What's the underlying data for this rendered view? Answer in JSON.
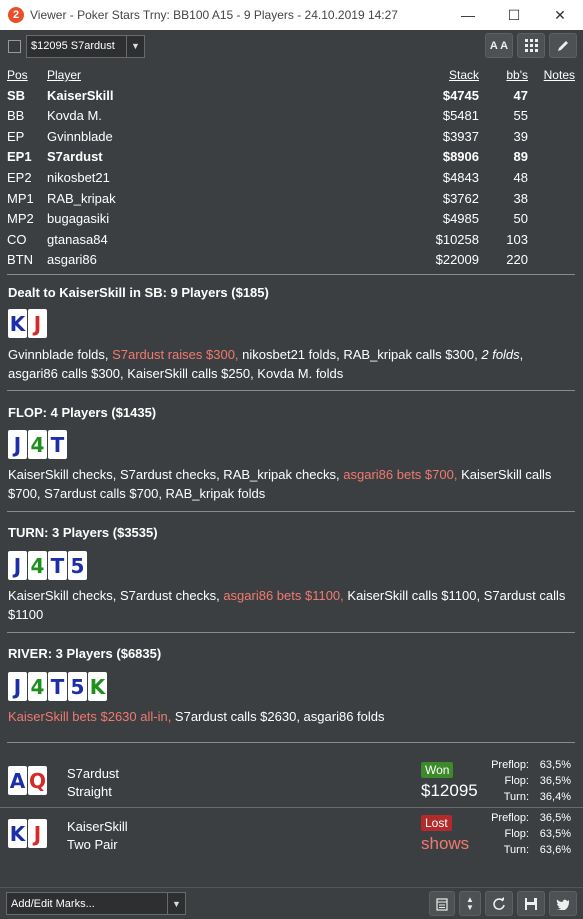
{
  "window": {
    "logo": "2",
    "title": "Viewer - Poker Stars Trny: BB100 A15 - 9 Players - 24.10.2019 14:27",
    "minimize": "—",
    "maximize": "☐",
    "close": "✕"
  },
  "toolbar": {
    "player_select": "$12095 S7ardust",
    "font_btn": "A A",
    "grid_icon": "grid-icon",
    "edit_icon": "pencil-icon"
  },
  "table": {
    "headers": {
      "pos": "Pos",
      "player": "Player",
      "stack": "Stack",
      "bbs": "bb's",
      "notes": "Notes"
    },
    "rows": [
      {
        "pos": "SB",
        "player": "KaiserSkill",
        "stack": "$4745",
        "bbs": "47",
        "bold": true
      },
      {
        "pos": "BB",
        "player": "Kovda M.",
        "stack": "$5481",
        "bbs": "55",
        "bold": false
      },
      {
        "pos": "EP",
        "player": "Gvinnblade",
        "stack": "$3937",
        "bbs": "39",
        "bold": false
      },
      {
        "pos": "EP1",
        "player": "S7ardust",
        "stack": "$8906",
        "bbs": "89",
        "bold": true
      },
      {
        "pos": "EP2",
        "player": "nikosbet21",
        "stack": "$4843",
        "bbs": "48",
        "bold": false
      },
      {
        "pos": "MP1",
        "player": "RAB_kripak",
        "stack": "$3762",
        "bbs": "38",
        "bold": false
      },
      {
        "pos": "MP2",
        "player": "bugagasiki",
        "stack": "$4985",
        "bbs": "50",
        "bold": false
      },
      {
        "pos": "CO",
        "player": "gtanasa84",
        "stack": "$10258",
        "bbs": "103",
        "bold": false
      },
      {
        "pos": "BTN",
        "player": "asgari86",
        "stack": "$22009",
        "bbs": "220",
        "bold": false
      }
    ]
  },
  "colors": {
    "red_suit": "#d42a2a",
    "blue_suit": "#1c2fa8",
    "green_suit": "#1f8f1f",
    "highlight": "#f07a70",
    "won": "#3d8a2a",
    "lost": "#b22a2a"
  },
  "streets": {
    "preflop": {
      "title": "Dealt to KaiserSkill in SB: 9 Players ($185)",
      "cards": [
        {
          "rank": "K",
          "suit": "blue"
        },
        {
          "rank": "J",
          "suit": "red"
        }
      ],
      "a1": "Gvinnblade folds, ",
      "a2": "S7ardust raises $300,",
      "a3": " nikosbet21 folds, RAB_kripak calls $300, ",
      "a4": "2 folds",
      "a5": ", asgari86 calls $300, KaiserSkill calls $250, Kovda M. folds"
    },
    "flop": {
      "title": "FLOP: 4 Players ($1435)",
      "cards": [
        {
          "rank": "J",
          "suit": "blue"
        },
        {
          "rank": "4",
          "suit": "green"
        },
        {
          "rank": "T",
          "suit": "blue"
        }
      ],
      "a1": "KaiserSkill checks, S7ardust checks, RAB_kripak checks, ",
      "a2": "asgari86 bets $700,",
      "a3": " KaiserSkill calls $700, S7ardust calls $700, RAB_kripak folds"
    },
    "turn": {
      "title": "TURN: 3 Players ($3535)",
      "cards": [
        {
          "rank": "J",
          "suit": "blue"
        },
        {
          "rank": "4",
          "suit": "green"
        },
        {
          "rank": "T",
          "suit": "blue"
        },
        {
          "rank": "5",
          "suit": "blue"
        }
      ],
      "a1": "KaiserSkill checks, S7ardust checks, ",
      "a2": "asgari86 bets $1100,",
      "a3": " KaiserSkill calls $1100, S7ardust calls $1100"
    },
    "river": {
      "title": "RIVER: 3 Players ($6835)",
      "cards": [
        {
          "rank": "J",
          "suit": "blue"
        },
        {
          "rank": "4",
          "suit": "green"
        },
        {
          "rank": "T",
          "suit": "blue"
        },
        {
          "rank": "5",
          "suit": "blue"
        },
        {
          "rank": "K",
          "suit": "green"
        }
      ],
      "a1": "KaiserSkill bets $2630 all-in,",
      "a2": " S7ardust calls $2630, asgari86 folds"
    }
  },
  "showdown": [
    {
      "cards": [
        {
          "rank": "A",
          "suit": "blue"
        },
        {
          "rank": "Q",
          "suit": "red"
        }
      ],
      "player": "S7ardust",
      "hand": "Straight",
      "badge": "Won",
      "amount": "$12095",
      "eq_labels": [
        "Preflop:",
        "Flop:",
        "Turn:"
      ],
      "eq_values": [
        "63,5%",
        "36,5%",
        "36,4%"
      ]
    },
    {
      "cards": [
        {
          "rank": "K",
          "suit": "blue"
        },
        {
          "rank": "J",
          "suit": "red"
        }
      ],
      "player": "KaiserSkill",
      "hand": "Two Pair",
      "badge": "Lost",
      "amount": "shows",
      "eq_labels": [
        "Preflop:",
        "Flop:",
        "Turn:"
      ],
      "eq_values": [
        "36,5%",
        "63,5%",
        "63,6%"
      ]
    }
  ],
  "bottom": {
    "marks_select": "Add/Edit Marks..."
  }
}
